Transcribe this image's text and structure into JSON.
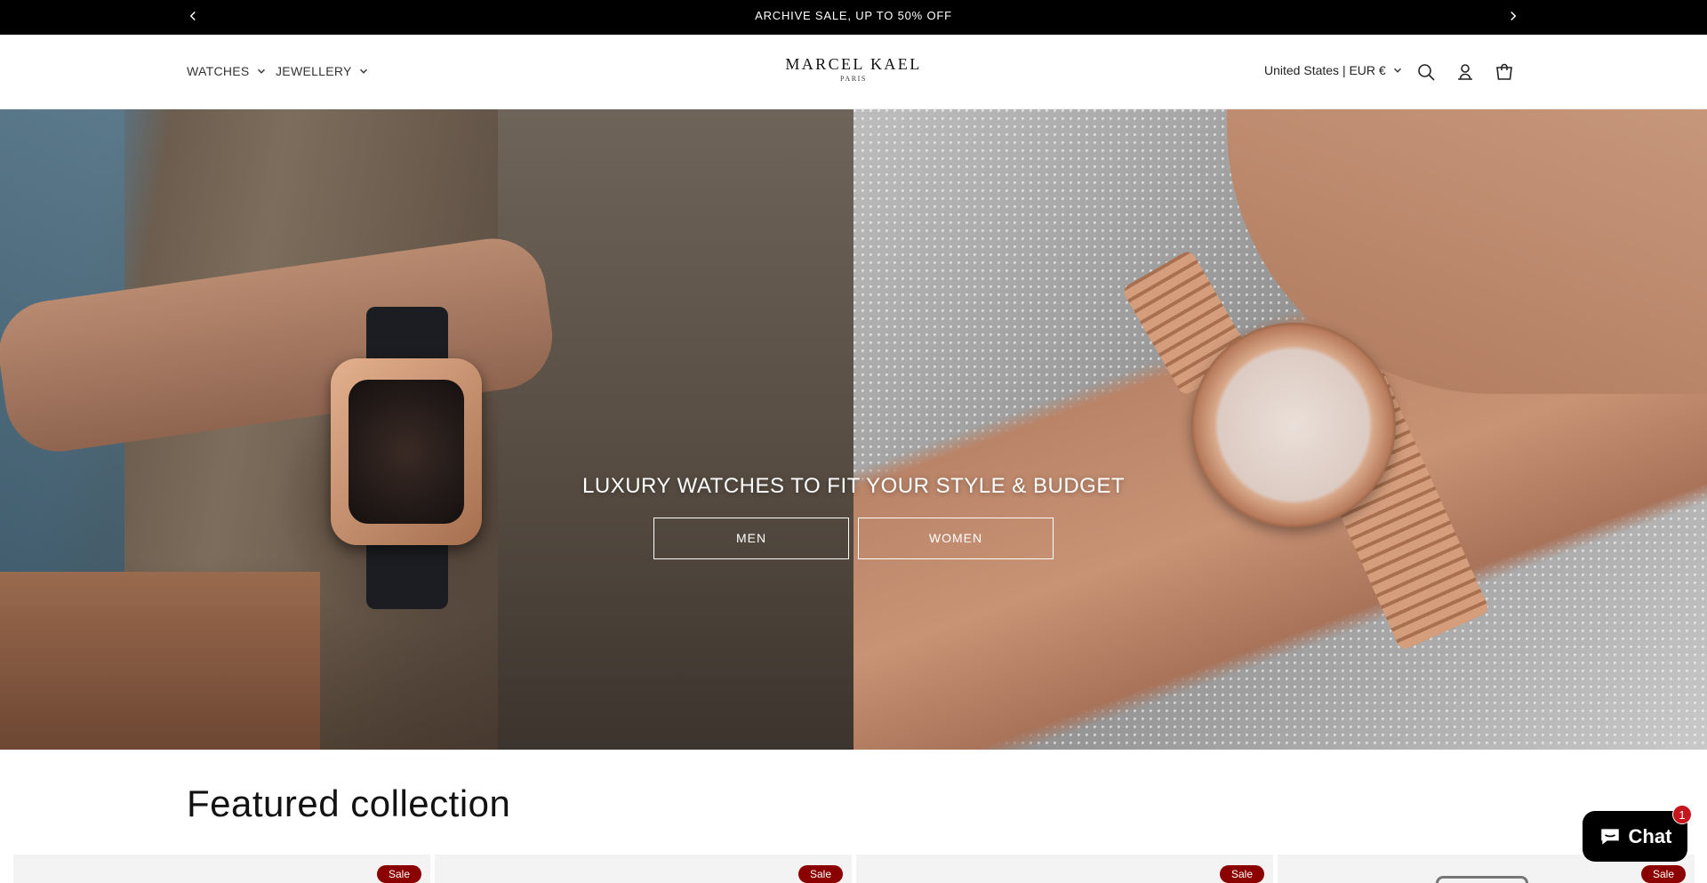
{
  "announcement": {
    "text": "ARCHIVE SALE, UP TO 50% OFF"
  },
  "header": {
    "nav": [
      {
        "label": "WATCHES",
        "icon": "chevron-down-icon"
      },
      {
        "label": "JEWELLERY",
        "icon": "chevron-down-icon"
      }
    ],
    "logo": {
      "brand": "MARCEL KAEL",
      "sub": "PARIS"
    },
    "locale": "United States | EUR €",
    "icons": [
      "search-icon",
      "account-icon",
      "cart-icon"
    ]
  },
  "hero": {
    "title": "LUXURY WATCHES TO FIT YOUR STYLE & BUDGET",
    "buttons": {
      "men": "MEN",
      "women": "WOMEN"
    }
  },
  "featured": {
    "title": "Featured collection",
    "cards": [
      {
        "badge": "Sale"
      },
      {
        "badge": "Sale"
      },
      {
        "badge": "Sale"
      },
      {
        "badge": "Sale"
      }
    ]
  },
  "chat": {
    "label": "Chat",
    "count": "1"
  },
  "colors": {
    "announcement_bg": "#000000",
    "sale_badge": "#8b0000",
    "chat_badge": "#c5161d"
  }
}
